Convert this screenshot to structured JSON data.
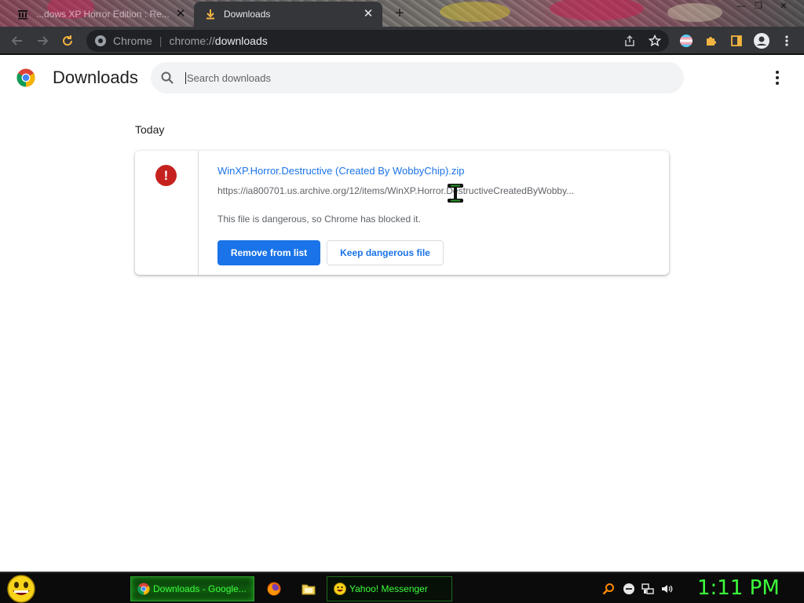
{
  "browser": {
    "tabs": [
      {
        "title": "...dows XP Horror Edition : Re...",
        "state": "inactive",
        "icon": "archive-icon"
      },
      {
        "title": "Downloads",
        "state": "active",
        "icon": "download-icon"
      }
    ],
    "window_controls": [
      "minimize",
      "restore",
      "close"
    ]
  },
  "toolbar": {
    "site_label": "Chrome",
    "url_scheme": "chrome://",
    "url_path": "downloads"
  },
  "page": {
    "title": "Downloads",
    "search": {
      "placeholder": "Search downloads",
      "value": ""
    },
    "date_header": "Today",
    "downloads": [
      {
        "file_name": "WinXP.Horror.Destructive (Created By WobbyChip).zip",
        "url": "https://ia800701.us.archive.org/12/items/WinXP.Horror.DestructiveCreatedByWobby...",
        "status": "This file is dangerous, so Chrome has blocked it.",
        "actions": {
          "remove": "Remove from list",
          "keep": "Keep dangerous file"
        }
      }
    ]
  },
  "taskbar": {
    "tasks": [
      {
        "label": "Downloads - Google...",
        "active": true,
        "icon": "chrome-icon"
      },
      {
        "label": "Yahoo! Messenger",
        "active": false,
        "icon": "smiley-icon"
      }
    ],
    "quick_launch": [
      "firefox-icon",
      "folder-icon"
    ],
    "tray": [
      "search-icon",
      "messenger-icon",
      "network-icon",
      "volume-icon"
    ],
    "clock": "1:11 PM"
  },
  "colors": {
    "accent": "#1a73e8",
    "danger": "#c5221f",
    "taskbar_text": "#3cff3c",
    "toolbar_bg": "#35363a"
  }
}
